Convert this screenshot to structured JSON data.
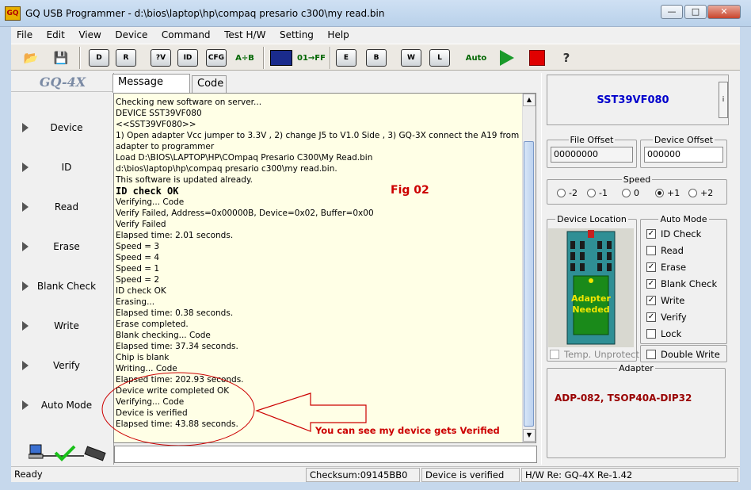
{
  "window": {
    "title": "GQ USB Programmer - d:\\bios\\laptop\\hp\\compaq presario c300\\my read.bin",
    "icon_text": "GQ",
    "minimize": "—",
    "maximize": "□",
    "close": "✕"
  },
  "menu": [
    "File",
    "Edit",
    "View",
    "Device",
    "Command",
    "Test H/W",
    "Setting",
    "Help"
  ],
  "toolbar": {
    "open_icon": "📂",
    "save_icon": "💾",
    "buttons": [
      "D",
      "R",
      "?V",
      "ID",
      "CFG",
      "A÷B",
      "",
      "01→FF",
      "E",
      "B",
      "W",
      "L",
      "Auto",
      "",
      ""
    ],
    "help_label": "?"
  },
  "left_panel": {
    "logo": "GQ-4X",
    "nav": [
      "Device",
      "ID",
      "Read",
      "Erase",
      "Blank Check",
      "Write",
      "Verify",
      "Auto Mode"
    ]
  },
  "tabs": {
    "message_log": "Message Log",
    "code": "Code"
  },
  "log": [
    {
      "text": "Checking new software on server...",
      "big": false
    },
    {
      "text": "DEVICE SST39VF080",
      "big": false
    },
    {
      "text": "<<SST39VF080>>",
      "big": false
    },
    {
      "text": "1) Open adapter Vcc jumper to 3.3V , 2) change J5 to V1.0 Side , 3) GQ-3X connect the A19 from",
      "big": false
    },
    {
      "text": "adapter to programmer",
      "big": false
    },
    {
      "text": "Load D:\\BIOS\\LAPTOP\\HP\\COmpaq Presario C300\\My Read.bin",
      "big": false
    },
    {
      "text": "d:\\bios\\laptop\\hp\\compaq presario c300\\my read.bin.",
      "big": false
    },
    {
      "text": "This software is updated already.",
      "big": false
    },
    {
      "text": "ID check OK",
      "big": true
    },
    {
      "text": "Verifying... Code",
      "big": false
    },
    {
      "text": "Verify Failed, Address=0x00000B, Device=0x02, Buffer=0x00",
      "big": false
    },
    {
      "text": "Verify Failed",
      "big": false
    },
    {
      "text": "Elapsed time: 2.01 seconds.",
      "big": false
    },
    {
      "text": "Speed = 3",
      "big": false
    },
    {
      "text": "Speed = 4",
      "big": false
    },
    {
      "text": "Speed = 1",
      "big": false
    },
    {
      "text": "Speed = 2",
      "big": false
    },
    {
      "text": "ID check OK",
      "big": false
    },
    {
      "text": "Erasing...",
      "big": false
    },
    {
      "text": "Elapsed time: 0.38 seconds.",
      "big": false
    },
    {
      "text": "Erase completed.",
      "big": false
    },
    {
      "text": "Blank checking... Code",
      "big": false
    },
    {
      "text": "Elapsed time: 37.34 seconds.",
      "big": false
    },
    {
      "text": "Chip is blank",
      "big": false
    },
    {
      "text": "Writing... Code",
      "big": false
    },
    {
      "text": "Elapsed time: 202.93 seconds.",
      "big": false
    },
    {
      "text": "Device write completed OK",
      "big": false
    },
    {
      "text": "Verifying... Code",
      "big": false
    },
    {
      "text": "Device is verified",
      "big": false
    },
    {
      "text": "Elapsed time: 43.88 seconds.",
      "big": false
    }
  ],
  "annotations": {
    "fig": "Fig 02",
    "note": "You can see my device gets Verified",
    "color": "#cc0000"
  },
  "right_panel": {
    "device_name": "SST39VF080",
    "info_button": "i",
    "file_offset_label": "File Offset",
    "file_offset_value": "00000000",
    "device_offset_label": "Device Offset",
    "device_offset_value": "000000",
    "speed_label": "Speed",
    "speed_options": [
      {
        "label": "-2",
        "selected": false
      },
      {
        "label": "-1",
        "selected": false
      },
      {
        "label": "0",
        "selected": false
      },
      {
        "label": "+1",
        "selected": true
      },
      {
        "label": "+2",
        "selected": false
      }
    ],
    "device_location_label": "Device Location",
    "chip_text": [
      "Adapter",
      "Needed"
    ],
    "temp_unprotect_label": "Temp. Unprotect",
    "auto_mode_label": "Auto Mode",
    "auto_mode": [
      {
        "label": "ID Check",
        "checked": true
      },
      {
        "label": "Read",
        "checked": false
      },
      {
        "label": "Erase",
        "checked": true
      },
      {
        "label": "Blank Check",
        "checked": true
      },
      {
        "label": "Write",
        "checked": true
      },
      {
        "label": "Verify",
        "checked": true
      },
      {
        "label": "Lock",
        "checked": false
      }
    ],
    "double_write_label": "Double Write",
    "adapter_label": "Adapter",
    "adapter_name": "ADP-082, TSOP40A-DIP32"
  },
  "status": {
    "state": "Ready",
    "checksum": "Checksum:09145BB0",
    "message": "Device is verified",
    "hw": "H/W Re: GQ-4X Re-1.42"
  }
}
